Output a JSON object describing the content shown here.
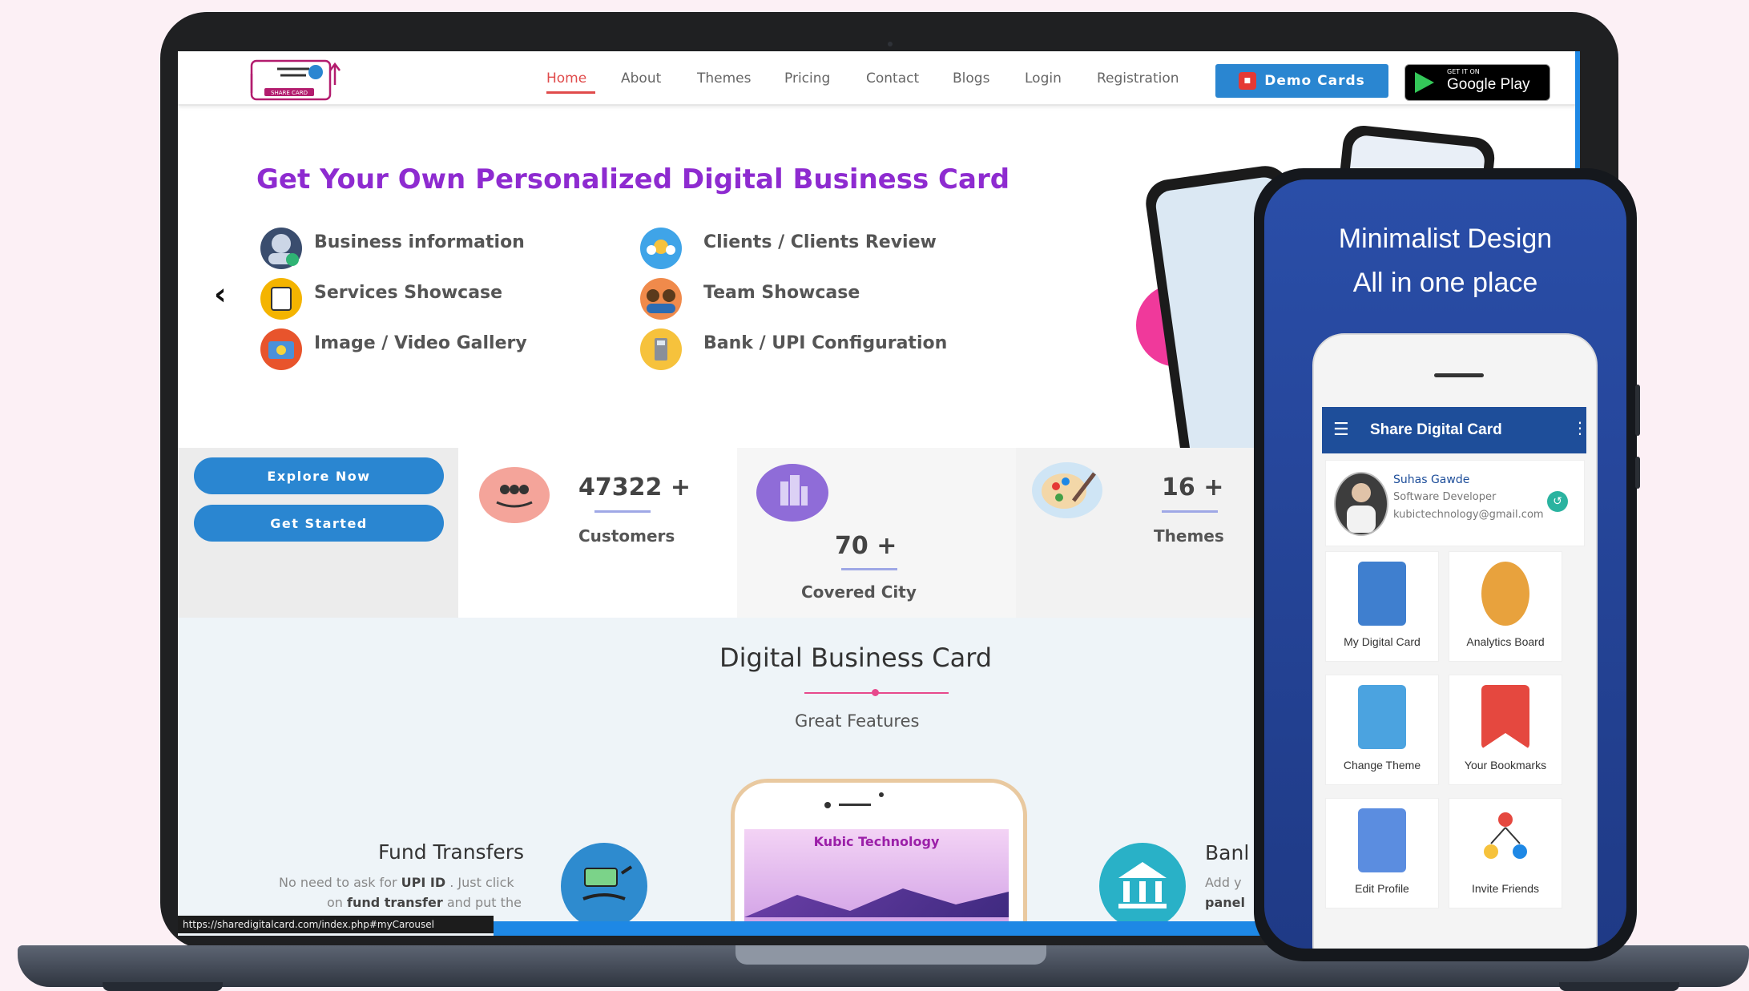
{
  "site": {
    "logo_text": "SHARE CARD",
    "status_url": "https://sharedigitalcard.com/index.php#myCarousel",
    "nav": [
      {
        "label": "Home",
        "active": true
      },
      {
        "label": "About"
      },
      {
        "label": "Themes"
      },
      {
        "label": "Pricing"
      },
      {
        "label": "Contact"
      },
      {
        "label": "Blogs"
      },
      {
        "label": "Login"
      },
      {
        "label": "Registration"
      }
    ],
    "demo_button": "Demo Cards",
    "google_play": {
      "small": "GET IT ON",
      "big": "Google Play"
    },
    "accent": "#2a86d1"
  },
  "hero": {
    "headline": "Get Your Own Personalized Digital Business Card",
    "headline_color": "#8e2bd0",
    "prev_icon": "chevron-left-icon",
    "features": [
      {
        "label": "Business information",
        "icon": "person-icon"
      },
      {
        "label": "Services Showcase",
        "icon": "notepad-icon"
      },
      {
        "label": "Image / Video Gallery",
        "icon": "photo-icon"
      },
      {
        "label": "Clients / Clients Review",
        "icon": "group-icon"
      },
      {
        "label": "Team Showcase",
        "icon": "team-icon"
      },
      {
        "label": "Bank / UPI Configuration",
        "icon": "calculator-icon"
      }
    ]
  },
  "stats": {
    "explore_label": "Explore Now",
    "start_label": "Get Started",
    "items": [
      {
        "value": "47322",
        "suffix": "+",
        "label": "Customers",
        "icon": "people-hand-icon"
      },
      {
        "value": "70",
        "suffix": "+",
        "label": "Covered City",
        "icon": "city-icon"
      },
      {
        "value": "16",
        "suffix": "+",
        "label": "Themes",
        "icon": "palette-icon"
      }
    ]
  },
  "features_section": {
    "title": "Digital Business Card",
    "subtitle": "Great Features",
    "phone_title": "Kubic Technology",
    "fund": {
      "title": "Fund Transfers",
      "desc_1_a": "No need to ask for ",
      "desc_1_b": "UPI ID",
      "desc_1_c": " . Just click",
      "desc_2_a": "on ",
      "desc_2_b": "fund transfer",
      "desc_2_c": " and put the"
    },
    "bank": {
      "title": "Banl",
      "desc_1": "Add y",
      "desc_2": "panel"
    }
  },
  "phone": {
    "headline_1": "Minimalist Design",
    "headline_2": "All in one place",
    "app_title": "Share Digital Card",
    "profile": {
      "name": "Suhas Gawde",
      "role": "Software Developer",
      "email": "kubictechnology@gmail.com"
    },
    "tiles": [
      {
        "label": "My Digital Card",
        "icon": "id-badge-icon",
        "color": "#3f7fcf"
      },
      {
        "label": "Analytics Board",
        "icon": "analytics-icon",
        "color": "#e8a23d"
      },
      {
        "label": "Change Theme",
        "icon": "theme-icon",
        "color": "#4ba3e0"
      },
      {
        "label": "Your Bookmarks",
        "icon": "bookmark-icon",
        "color": "#e5483f"
      },
      {
        "label": "Edit Profile",
        "icon": "edit-profile-icon",
        "color": "#5b8de0"
      },
      {
        "label": "Invite Friends",
        "icon": "invite-friends-icon",
        "color": "#e5483f"
      }
    ]
  }
}
